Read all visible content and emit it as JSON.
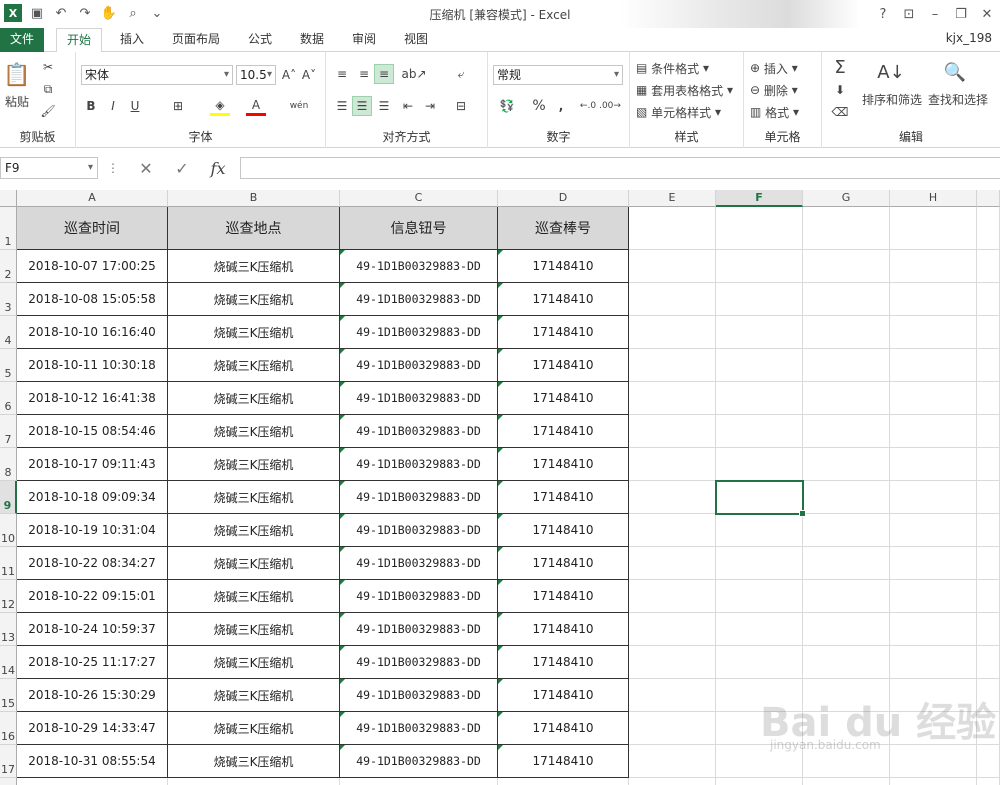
{
  "window": {
    "title": "压缩机  [兼容模式] - Excel",
    "user": "kjx_198"
  },
  "tabs": [
    "文件",
    "开始",
    "插入",
    "页面布局",
    "公式",
    "数据",
    "审阅",
    "视图"
  ],
  "ribbon": {
    "clipboard": {
      "label": "剪贴板",
      "paste": "粘贴"
    },
    "font": {
      "label": "字体",
      "name": "宋体",
      "size": "10.5",
      "bold": "B",
      "italic": "I",
      "underline": "U",
      "phonetic": "wén"
    },
    "alignment": {
      "label": "对齐方式"
    },
    "number": {
      "label": "数字",
      "format": "常规",
      "percent": "%",
      "comma": ","
    },
    "styles": {
      "label": "样式",
      "conditional": "条件格式",
      "table": "套用表格格式",
      "cell": "单元格样式"
    },
    "cells": {
      "label": "单元格",
      "insert": "插入",
      "delete": "删除",
      "format": "格式"
    },
    "editing": {
      "label": "编辑",
      "sort": "排序和筛选",
      "find": "查找和选择"
    }
  },
  "formula_bar": {
    "name_box": "F9",
    "fx": "fx",
    "value": ""
  },
  "columns": [
    "A",
    "B",
    "C",
    "D",
    "E",
    "F",
    "G",
    "H"
  ],
  "selected_column": "F",
  "selected_row": "9",
  "headers": [
    "巡查时间",
    "巡查地点",
    "信息钮号",
    "巡查棒号"
  ],
  "rows": [
    [
      "2018-10-07 17:00:25",
      "烧碱三K压缩机",
      "49-1D1B00329883-DD",
      "17148410"
    ],
    [
      "2018-10-08 15:05:58",
      "烧碱三K压缩机",
      "49-1D1B00329883-DD",
      "17148410"
    ],
    [
      "2018-10-10 16:16:40",
      "烧碱三K压缩机",
      "49-1D1B00329883-DD",
      "17148410"
    ],
    [
      "2018-10-11 10:30:18",
      "烧碱三K压缩机",
      "49-1D1B00329883-DD",
      "17148410"
    ],
    [
      "2018-10-12 16:41:38",
      "烧碱三K压缩机",
      "49-1D1B00329883-DD",
      "17148410"
    ],
    [
      "2018-10-15 08:54:46",
      "烧碱三K压缩机",
      "49-1D1B00329883-DD",
      "17148410"
    ],
    [
      "2018-10-17 09:11:43",
      "烧碱三K压缩机",
      "49-1D1B00329883-DD",
      "17148410"
    ],
    [
      "2018-10-18 09:09:34",
      "烧碱三K压缩机",
      "49-1D1B00329883-DD",
      "17148410"
    ],
    [
      "2018-10-19 10:31:04",
      "烧碱三K压缩机",
      "49-1D1B00329883-DD",
      "17148410"
    ],
    [
      "2018-10-22 08:34:27",
      "烧碱三K压缩机",
      "49-1D1B00329883-DD",
      "17148410"
    ],
    [
      "2018-10-22 09:15:01",
      "烧碱三K压缩机",
      "49-1D1B00329883-DD",
      "17148410"
    ],
    [
      "2018-10-24 10:59:37",
      "烧碱三K压缩机",
      "49-1D1B00329883-DD",
      "17148410"
    ],
    [
      "2018-10-25 11:17:27",
      "烧碱三K压缩机",
      "49-1D1B00329883-DD",
      "17148410"
    ],
    [
      "2018-10-26 15:30:29",
      "烧碱三K压缩机",
      "49-1D1B00329883-DD",
      "17148410"
    ],
    [
      "2018-10-29 14:33:47",
      "烧碱三K压缩机",
      "49-1D1B00329883-DD",
      "17148410"
    ],
    [
      "2018-10-31 08:55:54",
      "烧碱三K压缩机",
      "49-1D1B00329883-DD",
      "17148410"
    ]
  ],
  "watermark": {
    "text": "Bai du 经验",
    "sub": "jingyan.baidu.com"
  }
}
